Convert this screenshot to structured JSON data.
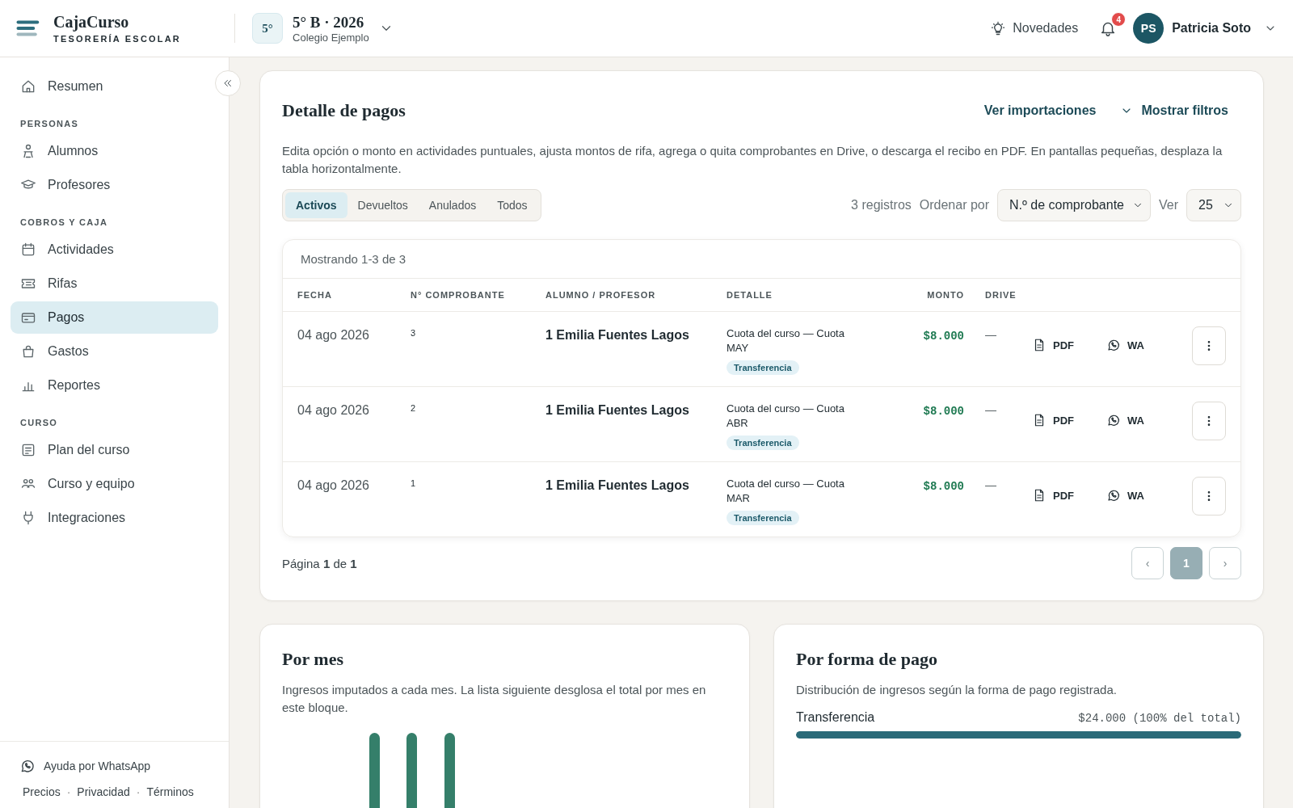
{
  "header": {
    "brand": {
      "name": "CajaCurso",
      "tagline": "TESORERÍA ESCOLAR"
    },
    "course": {
      "badge": "5°",
      "title": "5° B · 2026",
      "school": "Colegio Ejemplo"
    },
    "news": "Novedades",
    "notifications": {
      "count": "4"
    },
    "user": {
      "initials": "PS",
      "name": "Patricia Soto"
    }
  },
  "sidebar": {
    "groups": [
      {
        "items": [
          {
            "label": "Resumen",
            "selected": false
          }
        ]
      },
      {
        "heading": "PERSONAS",
        "items": [
          {
            "label": "Alumnos",
            "selected": false
          },
          {
            "label": "Profesores",
            "selected": false
          }
        ]
      },
      {
        "heading": "COBROS Y CAJA",
        "items": [
          {
            "label": "Actividades",
            "selected": false
          },
          {
            "label": "Rifas",
            "selected": false
          },
          {
            "label": "Pagos",
            "selected": true
          },
          {
            "label": "Gastos",
            "selected": false
          },
          {
            "label": "Reportes",
            "selected": false
          }
        ]
      },
      {
        "heading": "CURSO",
        "items": [
          {
            "label": "Plan del curso",
            "selected": false
          },
          {
            "label": "Curso y equipo",
            "selected": false
          },
          {
            "label": "Integraciones",
            "selected": false
          }
        ]
      }
    ],
    "help": "Ayuda por WhatsApp",
    "links": [
      "Precios",
      "Privacidad",
      "Términos"
    ],
    "separator": "·"
  },
  "payments": {
    "title": "Detalle de pagos",
    "actions": [
      "Ver importaciones",
      "Mostrar filtros"
    ],
    "description": "Edita opción o monto en actividades puntuales, ajusta montos de rifa, agrega o quita comprobantes en Drive, o descarga el recibo en PDF. En pantallas pequeñas, desplaza la tabla horizontalmente.",
    "tabs": [
      {
        "label": "Activos",
        "selected": true
      },
      {
        "label": "Devueltos",
        "selected": false
      },
      {
        "label": "Anulados",
        "selected": false
      },
      {
        "label": "Todos",
        "selected": false
      }
    ],
    "count": "3 registros",
    "sort_label": "Ordenar por",
    "sort_value": "N.º de comprobante",
    "view_label": "Ver",
    "view_value": "25",
    "table": {
      "caption": "Mostrando 1-3 de 3",
      "columns": [
        "FECHA",
        "N° COMPROBANTE",
        "ALUMNO / PROFESOR",
        "DETALLE",
        "MONTO",
        "DRIVE"
      ],
      "rows": [
        {
          "date": "04 ago 2026",
          "number": "3",
          "person": "1 Emilia Fuentes Lagos",
          "detail": "Cuota del curso — Cuota MAY",
          "method": "Transferencia",
          "amount": "$8.000",
          "drive": "—",
          "pdf": "PDF",
          "wa": "WA"
        },
        {
          "date": "04 ago 2026",
          "number": "2",
          "person": "1 Emilia Fuentes Lagos",
          "detail": "Cuota del curso — Cuota ABR",
          "method": "Transferencia",
          "amount": "$8.000",
          "drive": "—",
          "pdf": "PDF",
          "wa": "WA"
        },
        {
          "date": "04 ago 2026",
          "number": "1",
          "person": "1 Emilia Fuentes Lagos",
          "detail": "Cuota del curso — Cuota MAR",
          "method": "Transferencia",
          "amount": "$8.000",
          "drive": "—",
          "pdf": "PDF",
          "wa": "WA"
        }
      ]
    },
    "pagination": {
      "text": "Página **1** de **1**",
      "prev": "‹",
      "pages": [
        {
          "label": "1",
          "selected": true
        }
      ],
      "next": "›"
    }
  },
  "by_month": {
    "title": "Por mes",
    "description": "Ingresos imputados a cada mes. La lista siguiente desglosa el total por mes en este bloque."
  },
  "by_method": {
    "title": "Por forma de pago",
    "description": "Distribución de ingresos según la forma de pago registrada.",
    "items": [
      {
        "label": "Transferencia",
        "amount": "$24.000 (100% del total)",
        "level": 1
      }
    ]
  }
}
